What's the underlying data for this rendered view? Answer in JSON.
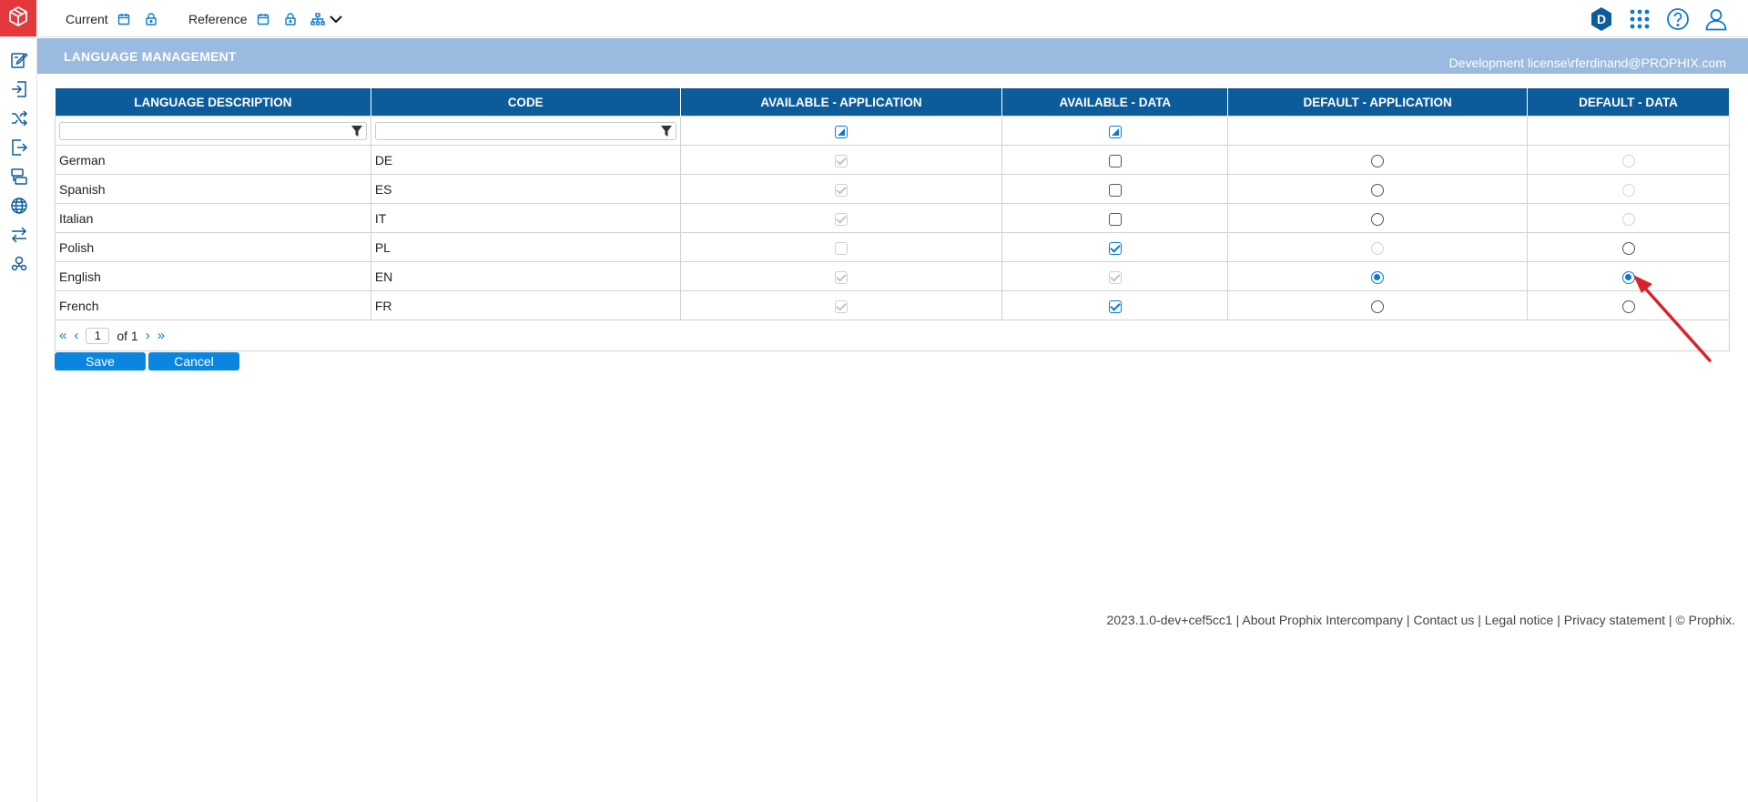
{
  "topbar": {
    "current_label": "Current",
    "reference_label": "Reference",
    "user_badge": "D"
  },
  "page": {
    "title": "LANGUAGE MANAGEMENT",
    "license": "Development license\\rferdinand@PROPHIX.com"
  },
  "grid": {
    "columns": [
      "LANGUAGE DESCRIPTION",
      "CODE",
      "AVAILABLE - APPLICATION",
      "AVAILABLE - DATA",
      "DEFAULT - APPLICATION",
      "DEFAULT - DATA"
    ],
    "rows": [
      {
        "description": "German",
        "code": "DE"
      },
      {
        "description": "Spanish",
        "code": "ES"
      },
      {
        "description": "Italian",
        "code": "IT"
      },
      {
        "description": "Polish",
        "code": "PL"
      },
      {
        "description": "English",
        "code": "EN"
      },
      {
        "description": "French",
        "code": "FR"
      }
    ]
  },
  "pager": {
    "page": "1",
    "of_label": "of 1"
  },
  "actions": {
    "save": "Save",
    "cancel": "Cancel"
  },
  "footer": {
    "version": "2023.1.0-dev+cef5cc1",
    "sep": " | ",
    "about": "About Prophix Intercompany",
    "contact": "Contact us",
    "legal": "Legal notice",
    "privacy": "Privacy statement",
    "copyright": "© Prophix."
  },
  "colors": {
    "header": "#0c5c9c",
    "title_band": "#9bbadf",
    "accent": "#0a79d4",
    "logo": "#e4393c",
    "annotation_arrow": "#d8232a"
  }
}
